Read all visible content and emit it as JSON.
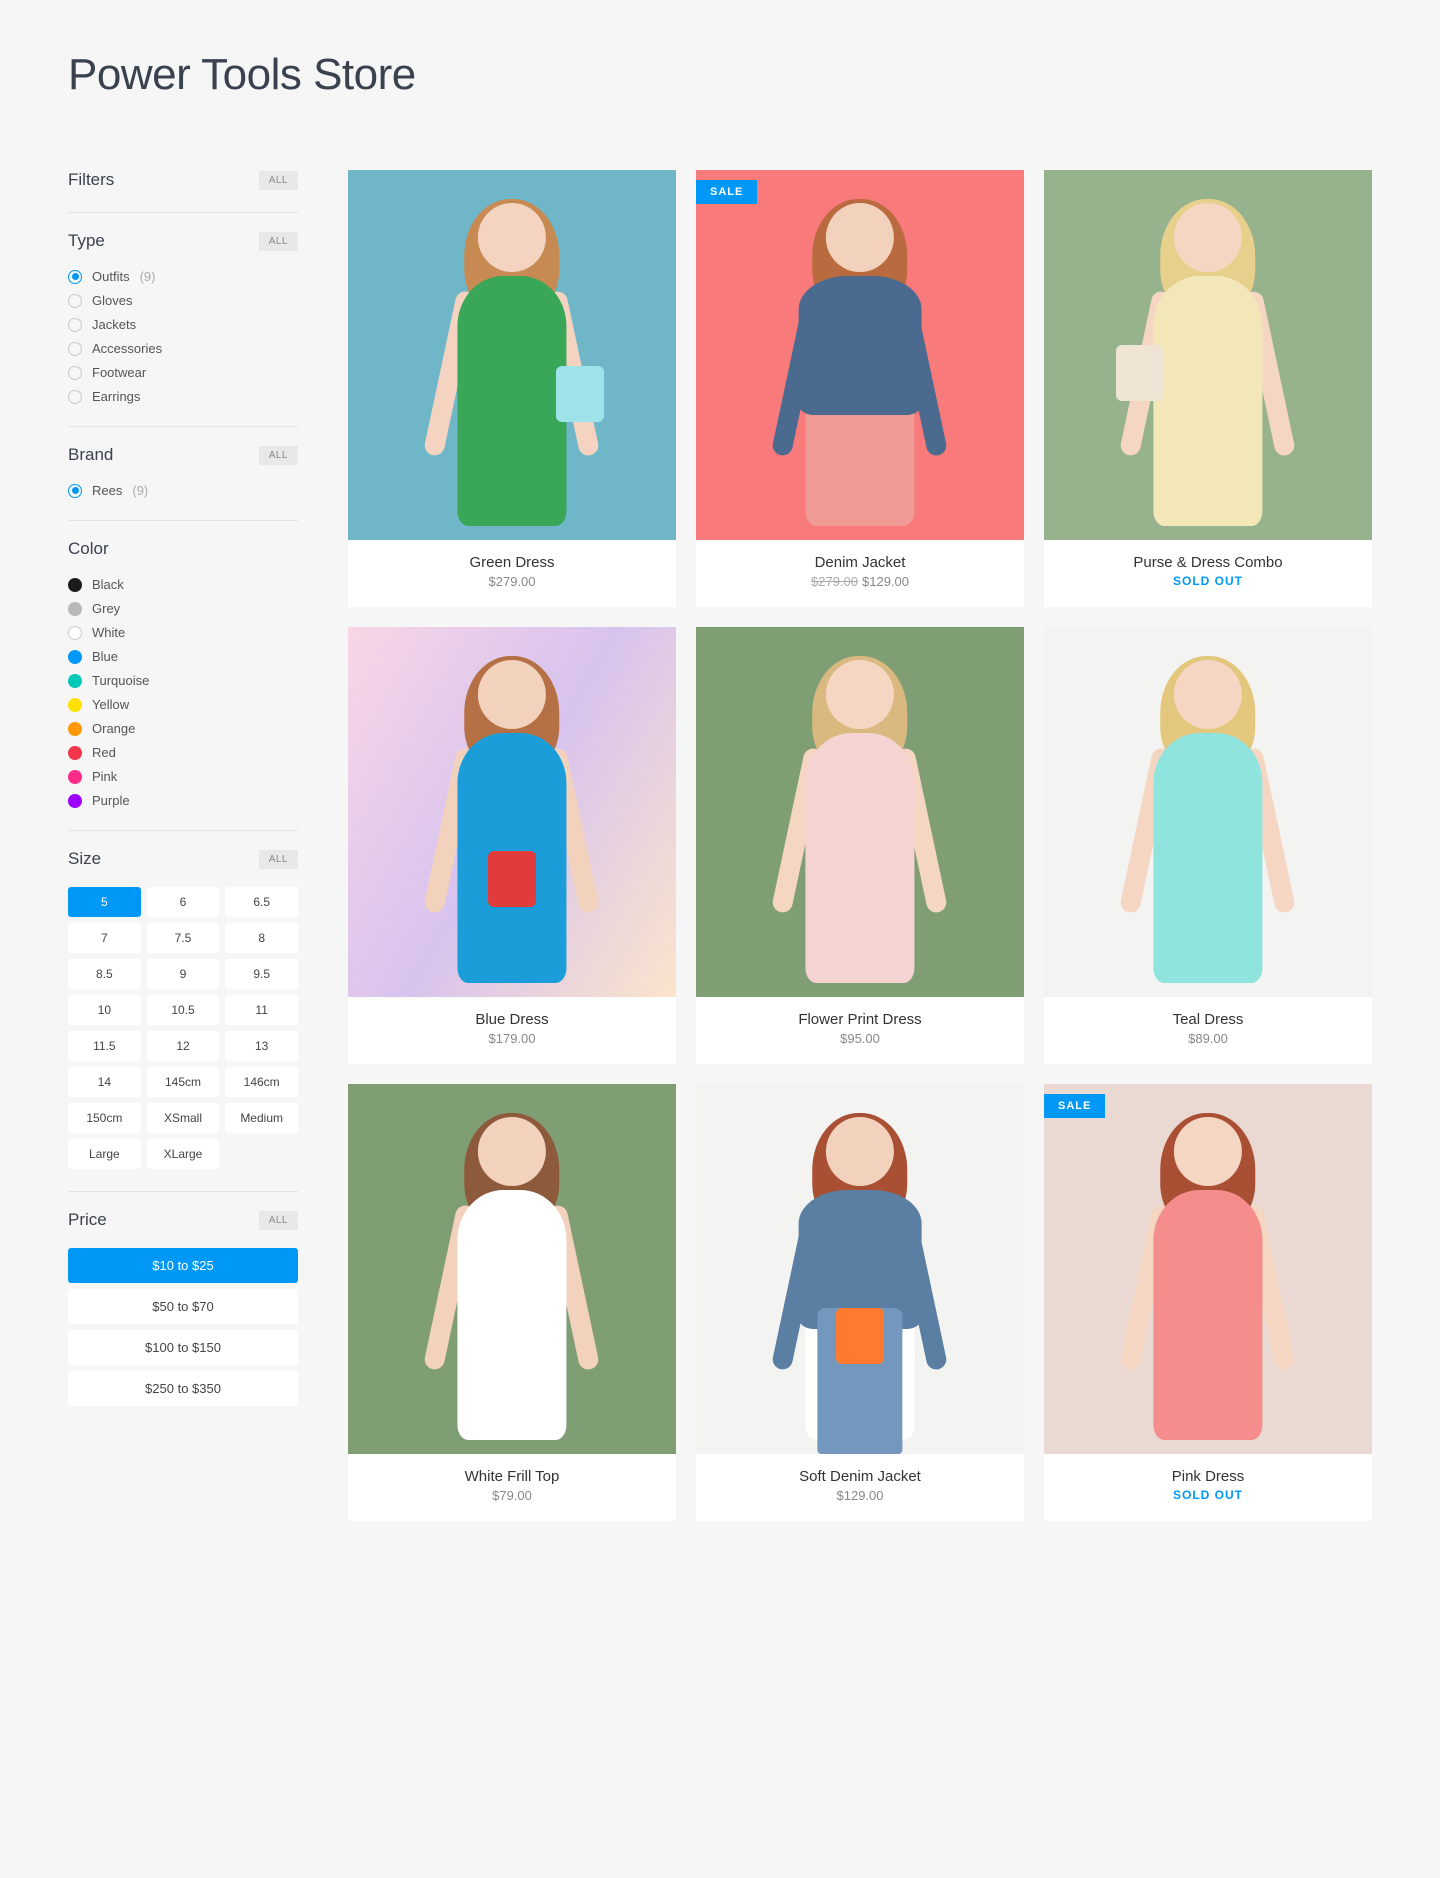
{
  "title": "Power Tools Store",
  "filters": {
    "header": {
      "label": "Filters",
      "all": "ALL"
    },
    "type": {
      "label": "Type",
      "all": "ALL",
      "items": [
        {
          "label": "Outfits",
          "count": "(9)",
          "checked": true
        },
        {
          "label": "Gloves",
          "checked": false
        },
        {
          "label": "Jackets",
          "checked": false
        },
        {
          "label": "Accessories",
          "checked": false
        },
        {
          "label": "Footwear",
          "checked": false
        },
        {
          "label": "Earrings",
          "checked": false
        }
      ]
    },
    "brand": {
      "label": "Brand",
      "all": "ALL",
      "items": [
        {
          "label": "Rees",
          "count": "(9)",
          "checked": true
        }
      ]
    },
    "color": {
      "label": "Color",
      "items": [
        {
          "label": "Black",
          "hex": "#1c1c1c"
        },
        {
          "label": "Grey",
          "hex": "#b9b9b9"
        },
        {
          "label": "White",
          "hex": "#ffffff"
        },
        {
          "label": "Blue",
          "hex": "#0098f7"
        },
        {
          "label": "Turquoise",
          "hex": "#00c9b8"
        },
        {
          "label": "Yellow",
          "hex": "#ffe000"
        },
        {
          "label": "Orange",
          "hex": "#ff9800"
        },
        {
          "label": "Red",
          "hex": "#f4364b"
        },
        {
          "label": "Pink",
          "hex": "#ff2d88"
        },
        {
          "label": "Purple",
          "hex": "#9d00ff"
        }
      ]
    },
    "size": {
      "label": "Size",
      "all": "ALL",
      "items": [
        "5",
        "6",
        "6.5",
        "7",
        "7.5",
        "8",
        "8.5",
        "9",
        "9.5",
        "10",
        "10.5",
        "11",
        "11.5",
        "12",
        "13",
        "14",
        "145cm",
        "146cm",
        "150cm",
        "XSmall",
        "Medium",
        "Large",
        "XLarge"
      ],
      "active": "5"
    },
    "price": {
      "label": "Price",
      "all": "ALL",
      "items": [
        "$10 to $25",
        "$50 to $70",
        "$100 to $150",
        "$250 to $350"
      ],
      "active": "$10 to $25"
    }
  },
  "badge_sale": "SALE",
  "sold_out_label": "SOLD OUT",
  "products": [
    {
      "name": "Green Dress",
      "price": "$279.00",
      "bg": "#6fb6c9",
      "dress": "#3aa657",
      "hair": "#c68a52",
      "skin": "#f4d4c0",
      "bag_color": "#9fe3ea",
      "bag_pos": "right"
    },
    {
      "name": "Denim Jacket",
      "price": "$129.00",
      "compare": "$279.00",
      "sale": true,
      "bg": "#f97a7a",
      "dress": "#f09a96",
      "jacket": "#4a6b8f",
      "hair": "#b96a3e",
      "skin": "#f3d2bd"
    },
    {
      "name": "Purse & Dress Combo",
      "sold_out": true,
      "bg": "#97b38e",
      "dress": "#f3e6b8",
      "hair": "#e7d08b",
      "skin": "#f4d6c3",
      "bag_color": "#efe3d3",
      "bag_pos": "left"
    },
    {
      "name": "Blue Dress",
      "price": "$179.00",
      "bg": "linear-gradient(120deg,#f8d6e6,#d7c3ee,#fbe4cc)",
      "dress": "#1a9dd9",
      "hair": "#b57046",
      "skin": "#f3d2bd",
      "bag_color": "#e23b3b",
      "bag_pos": "center"
    },
    {
      "name": "Flower Print Dress",
      "price": "$95.00",
      "bg": "#809e74",
      "dress": "#f6d3d3",
      "hair": "#d9b980",
      "skin": "#f4d6c3"
    },
    {
      "name": "Teal Dress",
      "price": "$89.00",
      "bg": "#f3f3f1",
      "dress": "#8fe4de",
      "hair": "#e3c77c",
      "skin": "#f4d6c3"
    },
    {
      "name": "White Frill Top",
      "price": "$79.00",
      "bg": "#809e74",
      "dress": "#ffffff",
      "hair": "#8d5a3c",
      "skin": "#f3d2bd"
    },
    {
      "name": "Soft Denim Jacket",
      "price": "$129.00",
      "bg": "#f3f3f1",
      "dress": "#ffffff",
      "jacket": "#5b7ea3",
      "pants": "#7498bd",
      "hair": "#a84f34",
      "skin": "#f3d2bd",
      "bag_color": "#ff7a2e",
      "bag_pos": "center"
    },
    {
      "name": "Pink Dress",
      "sold_out": true,
      "sale": true,
      "bg": "#ead8d2",
      "dress": "#f58d8d",
      "hair": "#a84f34",
      "skin": "#f4d6c3"
    }
  ]
}
